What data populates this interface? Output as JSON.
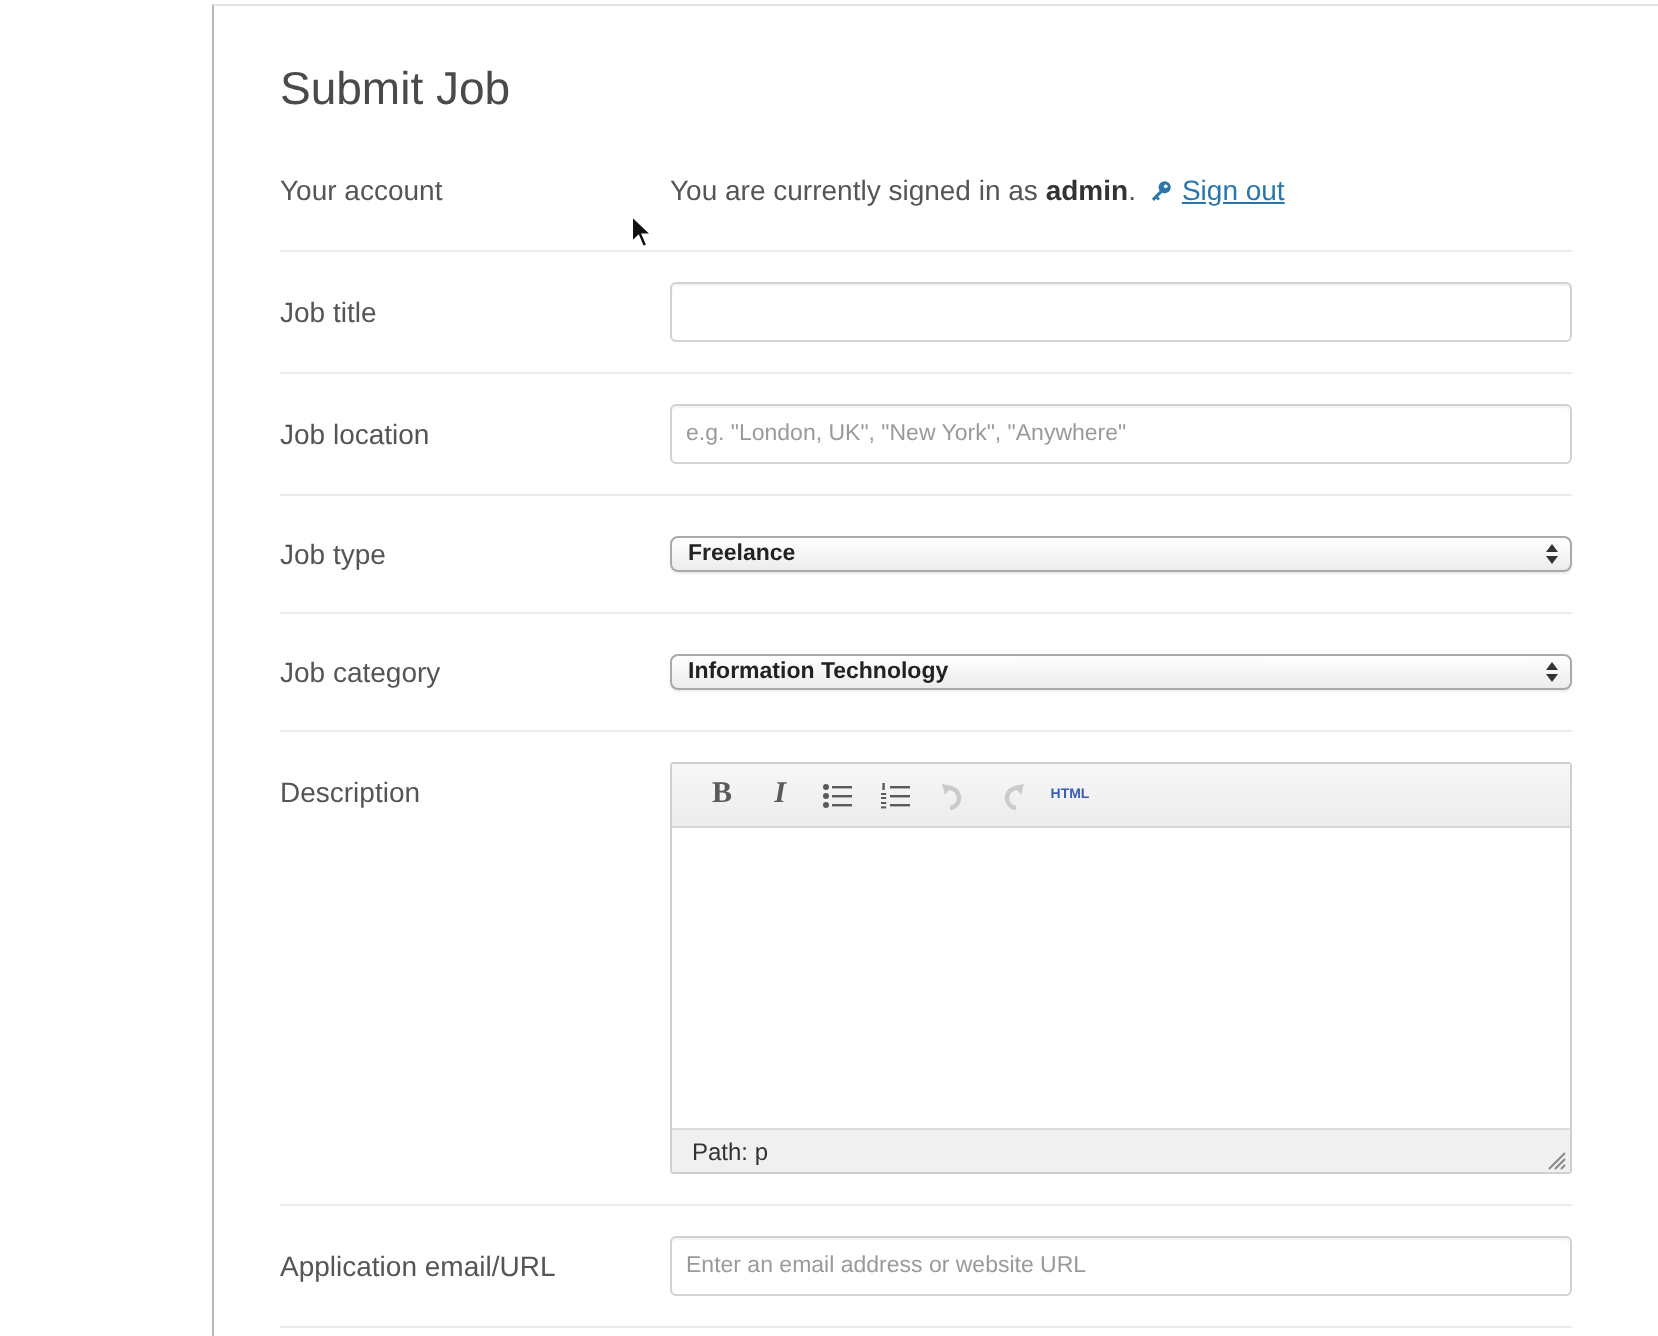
{
  "page": {
    "title": "Submit Job"
  },
  "fields": [
    {
      "kind": "account",
      "label": "Your account",
      "text": "You are currently signed in as **admin**.",
      "link": "Sign out"
    },
    {
      "kind": "text",
      "label": "Job title"
    },
    {
      "kind": "text",
      "label": "Job location",
      "placeholder": "e.g. \"London, UK\", \"New York\", \"Anywhere\""
    },
    {
      "kind": "select",
      "label": "Job type",
      "value": "Freelance"
    },
    {
      "kind": "select",
      "label": "Job category",
      "value": "Information Technology"
    },
    {
      "kind": "editor",
      "label": "Description",
      "toolbar": [
        {
          "kind": "bold",
          "label": "B",
          "disabled": false
        },
        {
          "kind": "italic",
          "label": "I",
          "disabled": false
        },
        {
          "kind": "bullets",
          "disabled": false
        },
        {
          "kind": "numbers",
          "disabled": false
        },
        {
          "kind": "undo",
          "disabled": true
        },
        {
          "kind": "redo",
          "disabled": true
        },
        {
          "kind": "html",
          "label": "HTML",
          "disabled": false
        }
      ],
      "path": "Path: p"
    },
    {
      "kind": "text",
      "label": "Application email/URL",
      "placeholder": "Enter an email address or website URL"
    }
  ]
}
